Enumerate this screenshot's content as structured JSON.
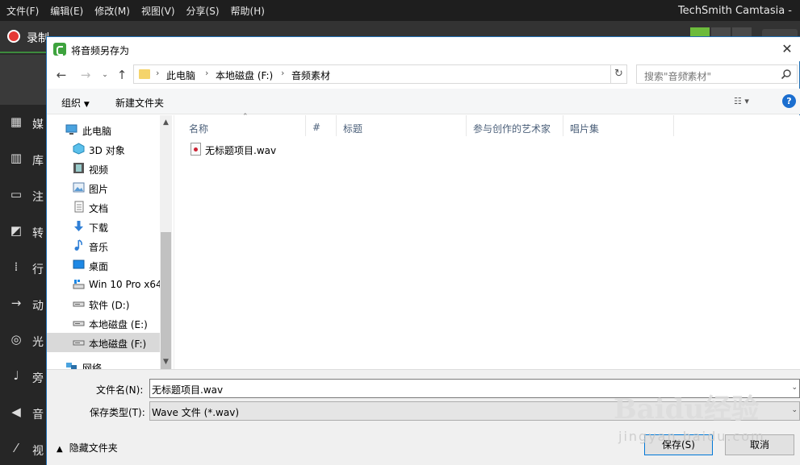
{
  "menu": [
    "文件(F)",
    "编辑(E)",
    "修改(M)",
    "视图(V)",
    "分享(S)",
    "帮助(H)"
  ],
  "app_title": "TechSmith Camtasia - ",
  "record_label": "录制",
  "sidebar": [
    {
      "icon": "media-icon",
      "label": "媒"
    },
    {
      "icon": "library-icon",
      "label": "库"
    },
    {
      "icon": "annotation-icon",
      "label": "注"
    },
    {
      "icon": "transition-icon",
      "label": "转"
    },
    {
      "icon": "behavior-icon",
      "label": "行"
    },
    {
      "icon": "animation-icon",
      "label": "动"
    },
    {
      "icon": "cursor-effect-icon",
      "label": "光"
    },
    {
      "icon": "narration-icon",
      "label": "旁"
    },
    {
      "icon": "audio-effect-icon",
      "label": "音"
    },
    {
      "icon": "visual-effect-icon",
      "label": "视"
    }
  ],
  "dialog": {
    "title": "将音频另存为",
    "close": "✕",
    "breadcrumb": [
      "此电脑",
      "本地磁盘 (F:)",
      "音频素材"
    ],
    "search_placeholder": "搜索\"音频素材\"",
    "commands": {
      "organize": "组织",
      "new_folder": "新建文件夹"
    },
    "help": "?",
    "tree": [
      {
        "icon": "pc-icon",
        "label": "此电脑",
        "root": true
      },
      {
        "icon": "3d-objects-icon",
        "label": "3D 对象"
      },
      {
        "icon": "video-icon",
        "label": "视频"
      },
      {
        "icon": "picture-icon",
        "label": "图片"
      },
      {
        "icon": "document-icon",
        "label": "文档"
      },
      {
        "icon": "download-icon",
        "label": "下载"
      },
      {
        "icon": "music-icon",
        "label": "音乐"
      },
      {
        "icon": "desktop-icon",
        "label": "桌面"
      },
      {
        "icon": "drive-icon",
        "label": "Win 10 Pro x64"
      },
      {
        "icon": "drive-icon",
        "label": "软件 (D:)"
      },
      {
        "icon": "drive-icon",
        "label": "本地磁盘 (E:)"
      },
      {
        "icon": "drive-icon",
        "label": "本地磁盘 (F:)",
        "selected": true
      },
      {
        "icon": "network-icon",
        "label": "网络",
        "root": true
      }
    ],
    "columns": [
      "名称",
      "#",
      "标题",
      "参与创作的艺术家",
      "唱片集"
    ],
    "files": [
      {
        "name": "无标题项目.wav"
      }
    ],
    "filename_label": "文件名(N):",
    "filename_value": "无标题项目.wav",
    "filetype_label": "保存类型(T):",
    "filetype_value": "Wave 文件 (*.wav)",
    "hide_folders": "隐藏文件夹",
    "save": "保存(S)",
    "cancel": "取消"
  },
  "watermark": {
    "logo": "Baidu经验",
    "sub": "jingyan.baidu.com"
  },
  "colors": {
    "accent": "#0078d7",
    "camtasia_green": "#3ea33e",
    "record_red": "#e53935"
  }
}
